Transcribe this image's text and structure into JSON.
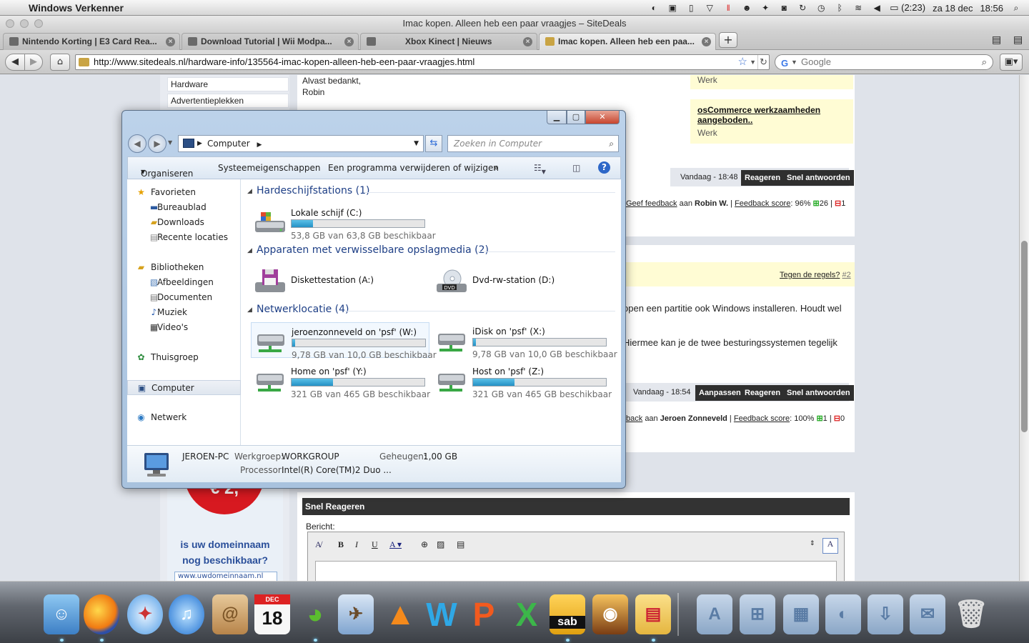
{
  "menubar": {
    "app_name": "Windows Verkenner",
    "battery": "(2:23)",
    "date": "za 18 dec",
    "time": "18:56"
  },
  "browser": {
    "window_title": "Imac kopen. Alleen heb een paar vraagjes – SiteDeals",
    "tabs": [
      {
        "label": "Nintendo Korting | E3 Card Rea..."
      },
      {
        "label": "Download Tutorial | Wii Modpa..."
      },
      {
        "label": "Xbox Kinect | Nieuws"
      },
      {
        "label": "Imac kopen. Alleen heb een paa..."
      }
    ],
    "url": "http://www.sitedeals.nl/hardware-info/135564-imac-kopen-alleen-heb-een-paar-vraagjes.html",
    "search_placeholder": "Google"
  },
  "page": {
    "sidebar_links": [
      "Hardware",
      "Advertentieplekken"
    ],
    "post_end": [
      "Alvast bedankt,",
      "Robin"
    ],
    "ad1_tail": "Werk",
    "ad2_title": "osCommerce werkzaamheden aangeboden..",
    "ad2_cat": "Werk",
    "post1": {
      "time": "Vandaag - 18:48",
      "btn_reply": "Reageren",
      "btn_quick": "Snel antwoorden",
      "feedback_link": "Geef feedback",
      "feedback_to": "aan",
      "user": "Robin W.",
      "score_label": "Feedback score",
      "score": ": 96%",
      "pos": "26",
      "neg": "1"
    },
    "report_link": "Tegen de regels?",
    "report_num": "#2",
    "reply_line1": "open een partitie ook Windows installeren. Houdt wel",
    "reply_line2": "Hiermee kan je de twee besturingssystemen tegelijk",
    "post2": {
      "time": "Vandaag - 18:54",
      "btn_edit": "Aanpassen",
      "btn_reply": "Reageren",
      "btn_quick": "Snel antwoorden",
      "feedback_link": "back",
      "feedback_to": "aan",
      "user": "Jeroen Zonneveld",
      "score_label": "Feedback score",
      "score": ": 100%",
      "pos": "1",
      "neg": "0"
    },
    "ad_price": "€ 2,",
    "domain_ad_1": "is uw domeinnaam",
    "domain_ad_2": "nog beschikbaar?",
    "domain_input": "www.uwdomeinnaam.nl",
    "quick_reply_title": "Snel Reageren",
    "message_label": "Bericht:"
  },
  "explorer": {
    "address": "Computer",
    "search_placeholder": "Zoeken in Computer",
    "commands": [
      "Organiseren",
      "Systeemeigenschappen",
      "Een programma verwijderen of wijzigen",
      "»"
    ],
    "nav": {
      "favorites": "Favorieten",
      "fav_items": [
        "Bureaublad",
        "Downloads",
        "Recente locaties"
      ],
      "libraries": "Bibliotheken",
      "lib_items": [
        "Afbeeldingen",
        "Documenten",
        "Muziek",
        "Video's"
      ],
      "homegroup": "Thuisgroep",
      "computer": "Computer",
      "network": "Netwerk"
    },
    "groups": {
      "hdd": "Hardeschijfstations (1)",
      "removable": "Apparaten met verwisselbare opslagmedia (2)",
      "network": "Netwerklocatie (4)"
    },
    "drives": {
      "c": {
        "name": "Lokale schijf (C:)",
        "size": "53,8 GB van 63,8 GB beschikbaar",
        "used": 0.16
      },
      "a": {
        "name": "Diskettestation (A:)"
      },
      "d": {
        "name": "Dvd-rw-station (D:)",
        "label": "DVD"
      },
      "w": {
        "name": "jeroenzonneveld on 'psf' (W:)",
        "size": "9,78 GB van 10,0 GB beschikbaar",
        "used": 0.02
      },
      "x": {
        "name": "iDisk on 'psf' (X:)",
        "size": "9,78 GB van 10,0 GB beschikbaar",
        "used": 0.02
      },
      "y": {
        "name": "Home on 'psf' (Y:)",
        "size": "321 GB van 465 GB beschikbaar",
        "used": 0.31
      },
      "z": {
        "name": "Host on 'psf' (Z:)",
        "size": "321 GB van 465 GB beschikbaar",
        "used": 0.31
      }
    },
    "status": {
      "pc": "JEROEN-PC",
      "wg_label": "Werkgroep:",
      "wg": "WORKGROUP",
      "mem_label": "Geheugen:",
      "mem": "1,00 GB",
      "cpu_label": "Processor:",
      "cpu": "Intel(R) Core(TM)2 Duo ..."
    }
  },
  "dock": {
    "calendar_month": "DEC",
    "calendar_day": "18",
    "sab_label": "sab"
  },
  "colors": {
    "accent_blue": "#1e3f86",
    "bar_fill": "#2591c4",
    "dark_button": "#2f2f2f",
    "ad_yellow": "#fffcd4"
  }
}
